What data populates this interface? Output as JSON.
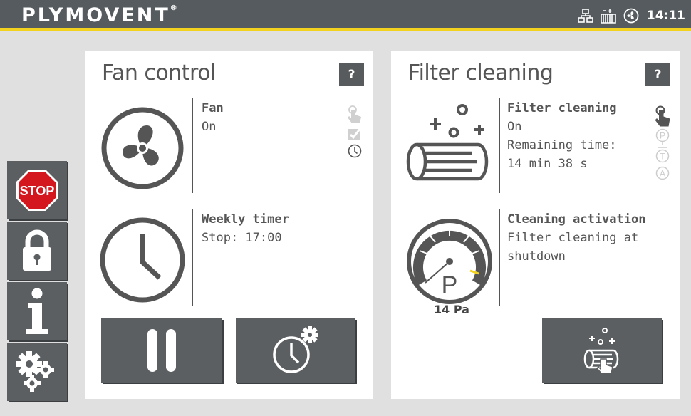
{
  "header": {
    "brand": "PLYMOVENT",
    "brand_mark": "®",
    "time": "14:11",
    "status_icons": [
      "network-icon",
      "filter-status-icon",
      "fan-status-icon"
    ]
  },
  "sidebar": {
    "stop_label": "STOP",
    "items": [
      "stop-icon",
      "lock-icon",
      "info-icon",
      "settings-gears-icon"
    ]
  },
  "fan_panel": {
    "title": "Fan control",
    "help_label": "?",
    "fan_header": "Fan",
    "fan_status": "On",
    "mode_icons": [
      "manual-hand-icon",
      "check-icon",
      "clock-icon"
    ],
    "timer_header": "Weekly timer",
    "timer_status": "Stop: 17:00",
    "buttons": [
      "pause-icon",
      "timer-settings-icon"
    ]
  },
  "filter_panel": {
    "title": "Filter cleaning",
    "help_label": "?",
    "cleaning_header": "Filter cleaning",
    "cleaning_status": "On",
    "remaining_label": "Remaining time:",
    "remaining_value": "14 min 38 s",
    "mode_icons": [
      "manual-hand-icon",
      "p-mode-icon",
      "t-mode-icon",
      "a-mode-icon"
    ],
    "activation_header": "Cleaning activation",
    "activation_line1": "Filter cleaning at",
    "activation_line2": "shutdown",
    "gauge_letter": "P",
    "pressure": "14 Pa",
    "button": "start-cleaning-icon"
  },
  "colors": {
    "topbar": "#555b5e",
    "accent": "#f2d21e",
    "button": "#5b5f62",
    "stop": "#d4161e"
  }
}
